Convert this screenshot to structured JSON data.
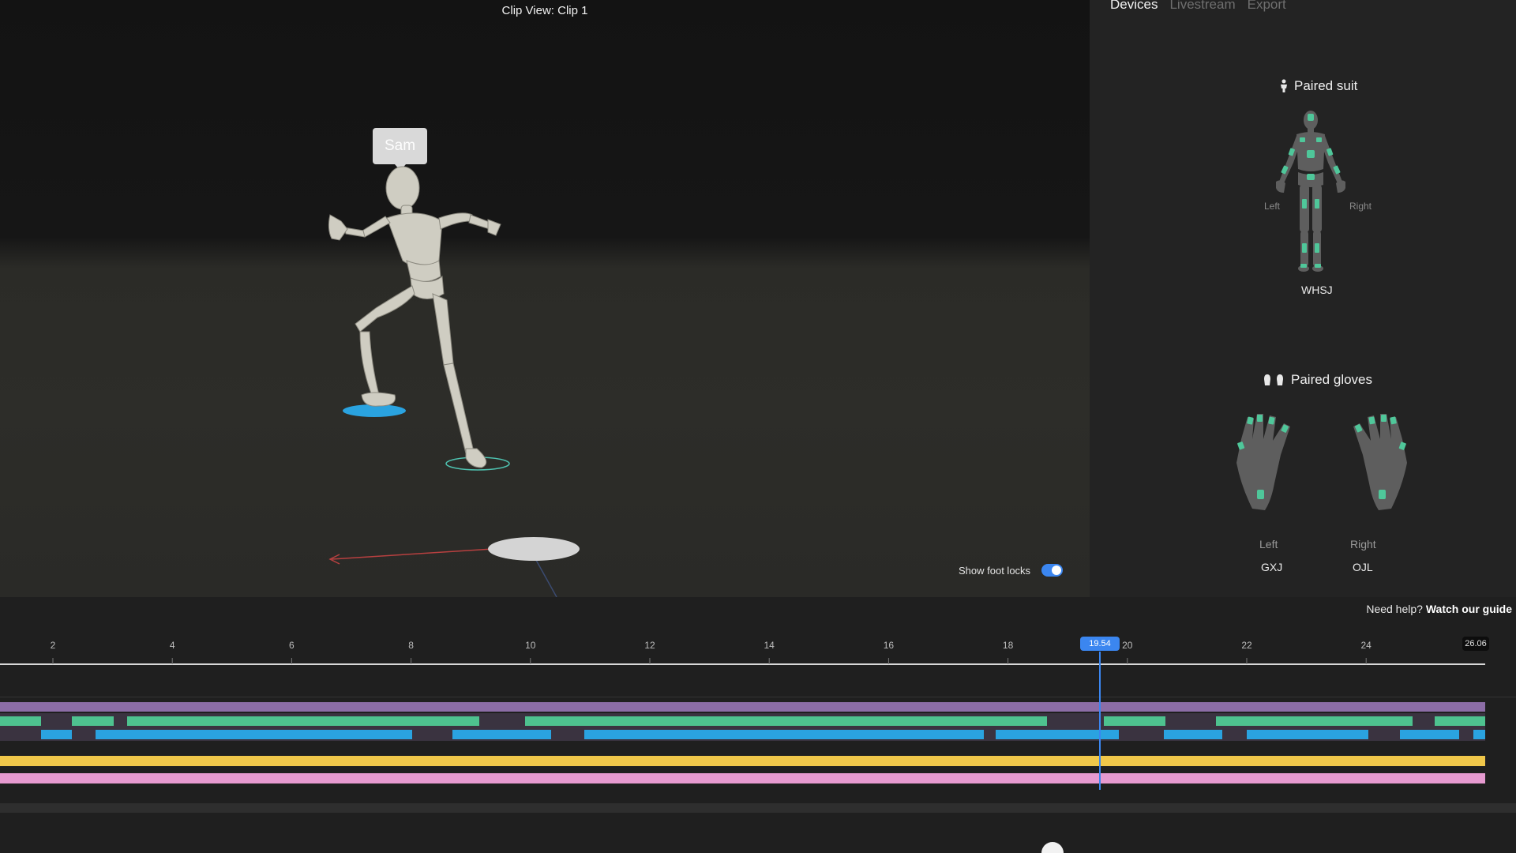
{
  "viewport": {
    "title": "Clip View: Clip 1",
    "actor_name": "Sam",
    "foot_locks_label": "Show foot locks",
    "foot_locks_enabled": true
  },
  "panel": {
    "tabs": [
      {
        "label": "Devices",
        "active": true
      },
      {
        "label": "Livestream",
        "active": false
      },
      {
        "label": "Export",
        "active": false
      }
    ],
    "suit": {
      "title": "Paired suit",
      "left_label": "Left",
      "right_label": "Right",
      "device_id": "WHSJ"
    },
    "gloves": {
      "title": "Paired gloves",
      "left_label": "Left",
      "right_label": "Right",
      "left_id": "GXJ",
      "right_id": "OJL"
    }
  },
  "help": {
    "prefix": "Need help?",
    "link": "Watch our guide"
  },
  "timeline": {
    "ticks": [
      "2",
      "4",
      "6",
      "8",
      "10",
      "12",
      "14",
      "16",
      "18",
      "20",
      "22",
      "24"
    ],
    "playhead_label": "19.54",
    "end_label": "26.06",
    "playhead_time": 19.54,
    "end_time": 26.06
  },
  "colors": {
    "accent": "#3b86f0",
    "track_purple": "#8c6da6",
    "track_green": "#4ec28f",
    "track_blue": "#2aa3e0",
    "track_yellow": "#f0c74a",
    "track_pink": "#e69ad0",
    "sensor_teal": "#4fc79a"
  }
}
